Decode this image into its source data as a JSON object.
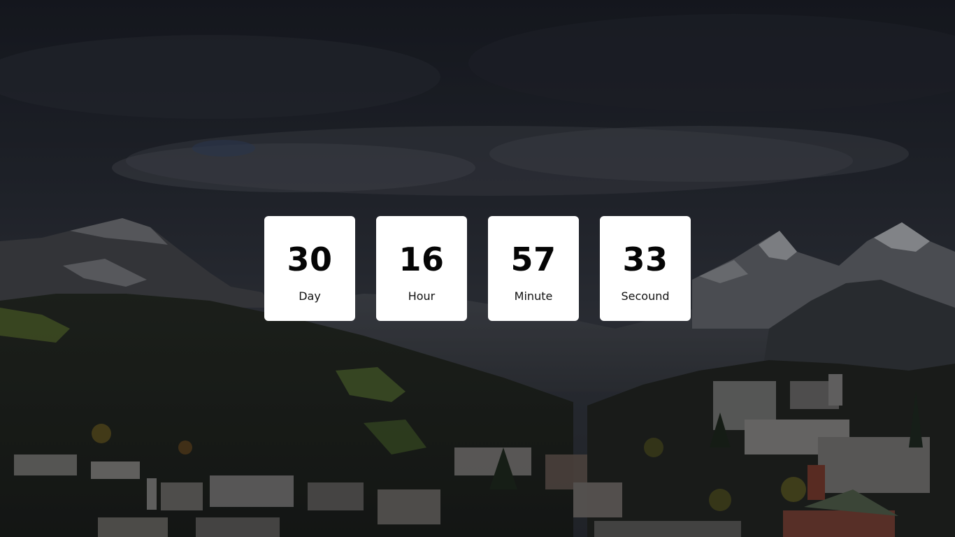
{
  "countdown": {
    "items": [
      {
        "value": "30",
        "label": "Day"
      },
      {
        "value": "16",
        "label": "Hour"
      },
      {
        "value": "57",
        "label": "Minute"
      },
      {
        "value": "33",
        "label": "Secound"
      }
    ]
  },
  "colors": {
    "card_background": "#ffffff",
    "number_text": "#050505",
    "label_text": "#111111",
    "backdrop": "#1c1e25"
  }
}
